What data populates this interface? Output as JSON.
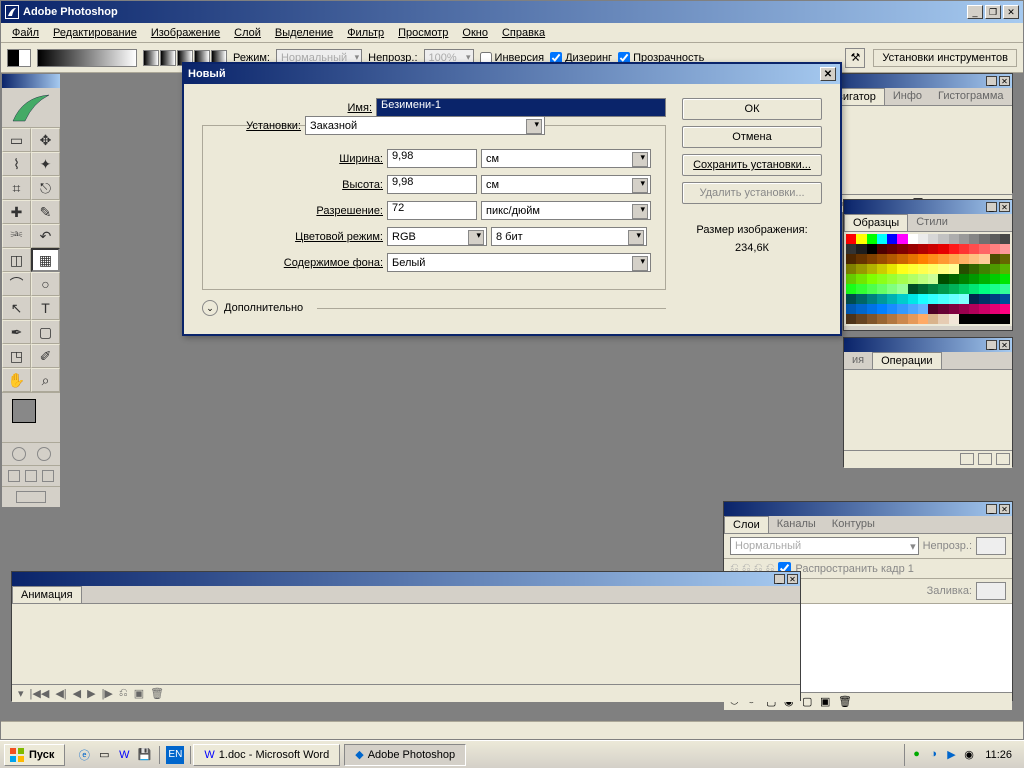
{
  "app": {
    "title": "Adobe Photoshop"
  },
  "menu": [
    "Файл",
    "Редактирование",
    "Изображение",
    "Слой",
    "Выделение",
    "Фильтр",
    "Просмотр",
    "Окно",
    "Справка"
  ],
  "toolbar": {
    "mode_label": "Режим:",
    "mode_value": "Нормальный",
    "opacity_label": "Непрозр.:",
    "opacity_value": "100%",
    "check_inverse": "Инверсия",
    "check_dither": "Дизеринг",
    "check_trans": "Прозрачность",
    "tool_presets": "Установки инструментов"
  },
  "panels": {
    "navigator": {
      "tabs": [
        "Навигатор",
        "Инфо",
        "Гистограмма"
      ]
    },
    "swatches": {
      "tabs": [
        "Образцы",
        "Стили"
      ]
    },
    "history": {
      "tabs": [
        "ия",
        "Операции"
      ]
    },
    "layers": {
      "tabs": [
        "Слои",
        "Каналы",
        "Контуры"
      ],
      "blend": "Нормальный",
      "opacity_lbl": "Непрозр.:",
      "spread": "Распространить кадр 1",
      "fill_lbl": "Заливка:"
    },
    "animation": {
      "tab": "Анимация"
    }
  },
  "dialog": {
    "title": "Новый",
    "name_lbl": "Имя:",
    "name_val": "Безимени-1",
    "preset_lbl": "Установки:",
    "preset_val": "Заказной",
    "width_lbl": "Ширина:",
    "width_val": "9,98",
    "width_unit": "см",
    "height_lbl": "Высота:",
    "height_val": "9,98",
    "height_unit": "см",
    "res_lbl": "Разрешение:",
    "res_val": "72",
    "res_unit": "пикс/дюйм",
    "mode_lbl": "Цветовой режим:",
    "mode_val": "RGB",
    "depth_val": "8 бит",
    "bg_lbl": "Содержимое фона:",
    "bg_val": "Белый",
    "advanced": "Дополнительно",
    "ok": "ОК",
    "cancel": "Отмена",
    "save_preset": "Сохранить установки...",
    "delete_preset": "Удалить установки...",
    "size_lbl": "Размер изображения:",
    "size_val": "234,6К"
  },
  "taskbar": {
    "start": "Пуск",
    "lang": "EN",
    "word": "1.doc - Microsoft Word",
    "ps": "Adobe Photoshop",
    "clock": "11:26"
  },
  "swatch_colors": [
    "#ff0000",
    "#ffff00",
    "#00ff00",
    "#00ffff",
    "#0000ff",
    "#ff00ff",
    "#ffffff",
    "#ebebeb",
    "#d6d6d6",
    "#c2c2c2",
    "#adadad",
    "#999999",
    "#858585",
    "#707070",
    "#5c5c5c",
    "#474747",
    "#333333",
    "#1e1e1e",
    "#000000",
    "#4d0000",
    "#660000",
    "#800000",
    "#990000",
    "#b20000",
    "#cc0000",
    "#e60000",
    "#ff1919",
    "#ff3333",
    "#ff4d4d",
    "#ff6666",
    "#ff8080",
    "#ff9999",
    "#4d2600",
    "#663300",
    "#804000",
    "#994d00",
    "#b25900",
    "#cc6600",
    "#e67300",
    "#ff8000",
    "#ff8c19",
    "#ff9933",
    "#ffa64d",
    "#ffb266",
    "#ffbf80",
    "#ffcc99",
    "#4d4d00",
    "#666600",
    "#808000",
    "#999900",
    "#b2b200",
    "#cccc00",
    "#e6e600",
    "#ffff19",
    "#ffff33",
    "#ffff4d",
    "#ffff66",
    "#ffff80",
    "#ffff99",
    "#264d00",
    "#336600",
    "#408000",
    "#4d9900",
    "#59b200",
    "#66cc00",
    "#73e600",
    "#80ff00",
    "#8cff19",
    "#99ff33",
    "#a6ff4d",
    "#b2ff66",
    "#bfff80",
    "#ccff99",
    "#004d00",
    "#006600",
    "#008000",
    "#009900",
    "#00b200",
    "#00cc00",
    "#00e600",
    "#19ff19",
    "#33ff33",
    "#4dff4d",
    "#66ff66",
    "#80ff80",
    "#99ff99",
    "#004d26",
    "#006633",
    "#008040",
    "#00994d",
    "#00b259",
    "#00cc66",
    "#00e673",
    "#00ff80",
    "#19ff8c",
    "#33ff99",
    "#004d4d",
    "#006666",
    "#008080",
    "#009999",
    "#00b2b2",
    "#00cccc",
    "#00e6e6",
    "#19ffff",
    "#33ffff",
    "#4dffff",
    "#66ffff",
    "#80ffff",
    "#00264d",
    "#003366",
    "#004080",
    "#004d99",
    "#0059b2",
    "#0066cc",
    "#0073e6",
    "#0080ff",
    "#198cff",
    "#3399ff",
    "#4da6ff",
    "#66b2ff",
    "#4d0026",
    "#660033",
    "#800040",
    "#99004d",
    "#b20059",
    "#cc0066",
    "#e60073",
    "#ff0080",
    "#4d3319",
    "#664422",
    "#80552b",
    "#996633",
    "#b27740",
    "#cc884d",
    "#e69959",
    "#ffaa66",
    "#d9b38c",
    "#e6ccb3",
    "#f2e6d9",
    "#000000",
    "#000000",
    "#000000",
    "#000000",
    "#000000"
  ]
}
